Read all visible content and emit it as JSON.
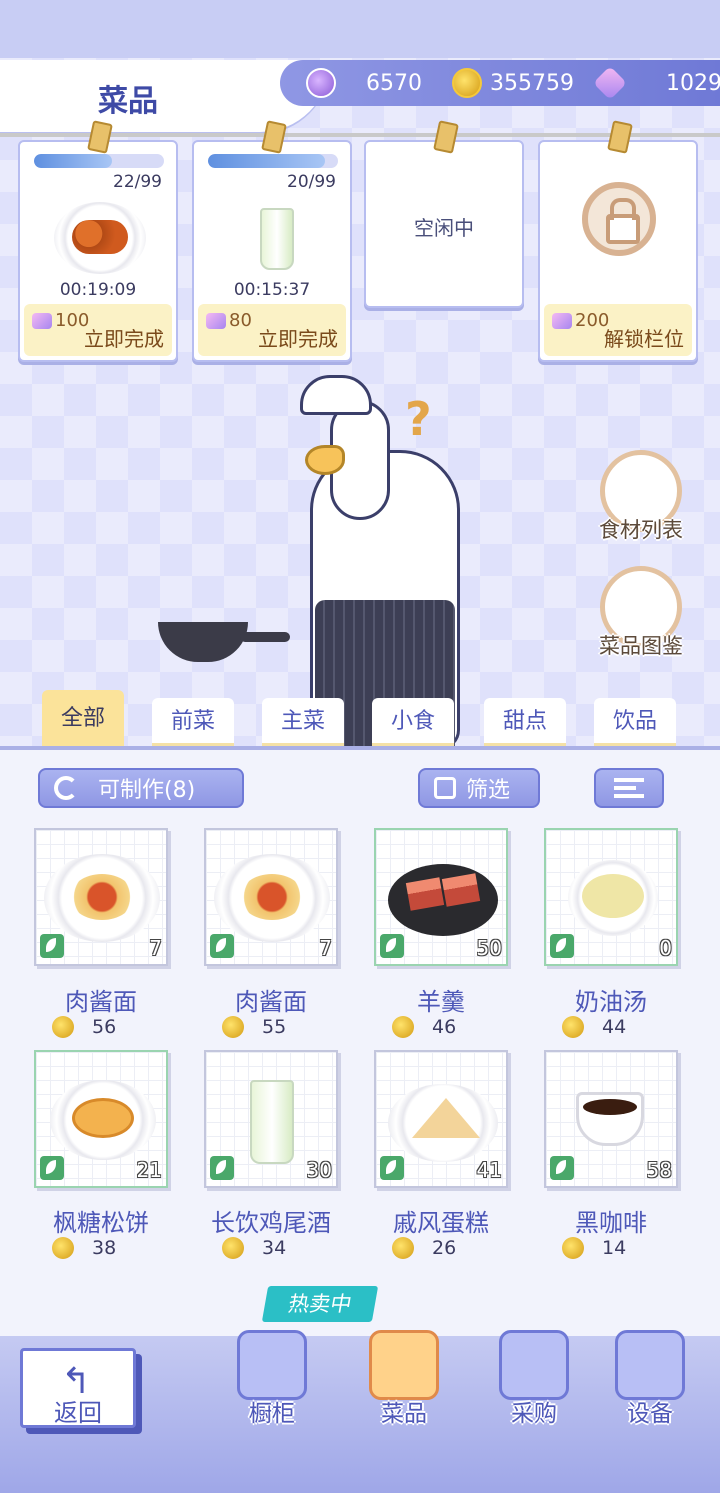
{
  "header": {
    "title": "菜品",
    "currency_purple": "6570",
    "currency_gold": "355759",
    "currency_gem": "1029"
  },
  "slots": [
    {
      "count": "22/99",
      "time": "00:19:09",
      "cost": "100",
      "action": "立即完成",
      "progress": 0.6,
      "food_icon": "meatball-skewers-icon"
    },
    {
      "count": "20/99",
      "time": "00:15:37",
      "cost": "80",
      "action": "立即完成",
      "progress": 0.9,
      "food_icon": "cocktail-glass-icon"
    },
    {
      "status": "空闲中"
    },
    {
      "cost": "200",
      "action": "解锁栏位",
      "icon": "lock-icon"
    }
  ],
  "side_buttons": {
    "ingredients": "食材列表",
    "catalog": "菜品图鉴"
  },
  "tabs": [
    "全部",
    "前菜",
    "主菜",
    "小食",
    "甜点",
    "饮品"
  ],
  "active_tab": "全部",
  "controls": {
    "craftable": "可制作(8)",
    "filter": "筛选"
  },
  "recipes": [
    {
      "name": "肉酱面",
      "price": "56",
      "qty": "7",
      "icon": "spaghetti-icon"
    },
    {
      "name": "肉酱面",
      "price": "55",
      "qty": "7",
      "icon": "spaghetti-icon"
    },
    {
      "name": "羊羹",
      "price": "46",
      "qty": "50",
      "icon": "yokan-icon"
    },
    {
      "name": "奶油汤",
      "price": "44",
      "qty": "0",
      "icon": "cream-soup-icon"
    },
    {
      "name": "枫糖松饼",
      "price": "38",
      "qty": "21",
      "icon": "pancake-icon"
    },
    {
      "name": "长饮鸡尾酒",
      "price": "34",
      "qty": "30",
      "icon": "cocktail-glass-icon"
    },
    {
      "name": "戚风蛋糕",
      "price": "26",
      "qty": "41",
      "icon": "chiffon-cake-icon"
    },
    {
      "name": "黑咖啡",
      "price": "14",
      "qty": "58",
      "icon": "coffee-cup-icon"
    }
  ],
  "bottom_nav": {
    "back": "返回",
    "hot_badge": "热卖中",
    "items": [
      "橱柜",
      "菜品",
      "采购",
      "设备"
    ]
  },
  "colors": {
    "accent": "#6f79d6",
    "tab_active": "#fbe39a",
    "hot_badge": "#2bbfc6"
  }
}
